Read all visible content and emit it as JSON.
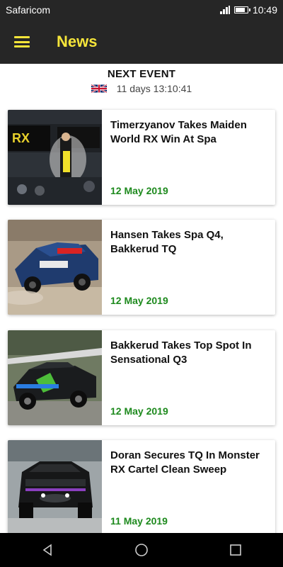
{
  "status_bar": {
    "carrier": "Safaricom",
    "time": "10:49",
    "battery_level": 0.85
  },
  "app_bar": {
    "title": "News",
    "menu_icon": "hamburger-menu-icon",
    "accent_color": "#f5e53a"
  },
  "next_event": {
    "heading": "NEXT EVENT",
    "flag_icon": "uk-flag-icon",
    "countdown": "11 days 13:10:41"
  },
  "news": [
    {
      "title": "Timerzyanov Takes Maiden World RX Win At Spa",
      "date": "12 May 2019"
    },
    {
      "title": "Hansen Takes Spa Q4, Bakkerud TQ",
      "date": "12 May 2019"
    },
    {
      "title": "Bakkerud Takes Top Spot In Sensational Q3",
      "date": "12 May 2019"
    },
    {
      "title": "Doran Secures TQ In Monster RX Cartel Clean Sweep",
      "date": "11 May 2019"
    }
  ],
  "colors": {
    "date_green": "#1e8a1e",
    "bar_dark": "#262626"
  }
}
